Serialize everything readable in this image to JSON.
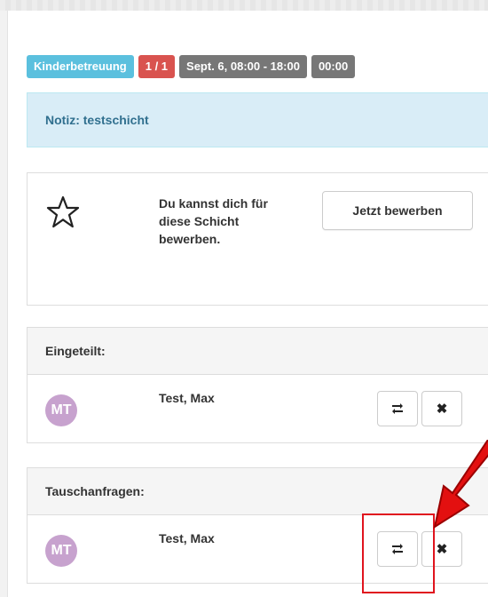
{
  "labels": {
    "category": "Kinderbetreuung",
    "count": "1 / 1",
    "datetime": "Sept. 6, 08:00 - 18:00",
    "duration": "00:00"
  },
  "note": "Notiz: testschicht",
  "apply": {
    "text": "Du kannst dich für diese Schicht bewerben.",
    "button": "Jetzt bewerben"
  },
  "assigned": {
    "title": "Eingeteilt:",
    "rows": [
      {
        "initials": "MT",
        "name": "Test, Max"
      }
    ]
  },
  "swap_requests": {
    "title": "Tauschanfragen:",
    "rows": [
      {
        "initials": "MT",
        "name": "Test, Max"
      }
    ]
  },
  "colors": {
    "info": "#5bc0de",
    "danger": "#d9534f",
    "default": "#777777",
    "avatar": "#c7a2ce",
    "highlight": "#e0141e"
  },
  "icons": {
    "swap": "swap-arrows-icon",
    "remove": "close-icon",
    "star": "star-outline-icon"
  }
}
